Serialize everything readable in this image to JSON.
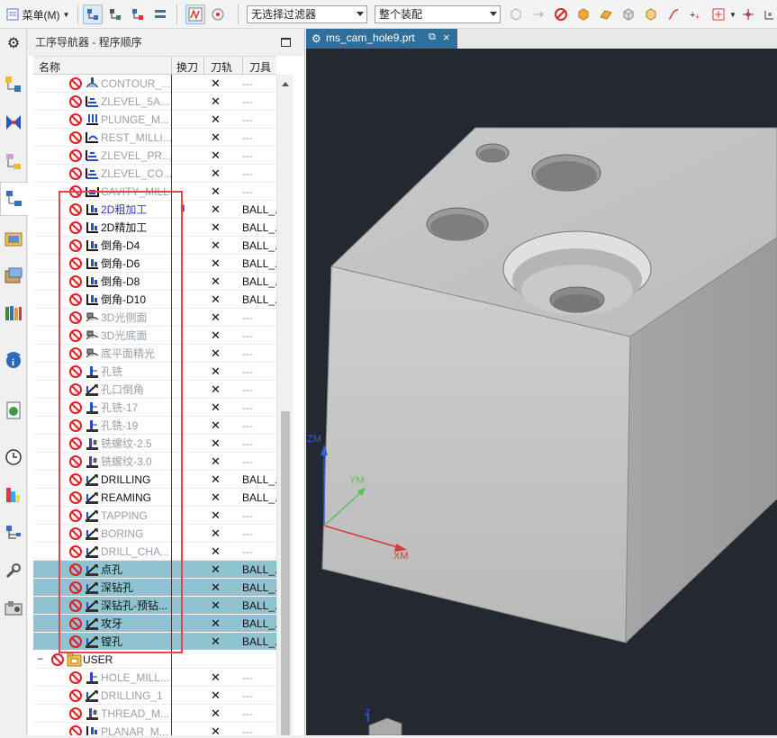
{
  "toolbar": {
    "menu_label": "菜单(M)",
    "filter_value": "无选择过滤器",
    "assembly_value": "整个装配"
  },
  "navigator": {
    "title": "工序导航器 - 程序顺序",
    "columns": [
      "名称",
      "换刀",
      "刀轨",
      "刀具"
    ]
  },
  "rows": [
    {
      "name": "CONTOUR_...",
      "style": "gray",
      "icon": "contour-op-icon",
      "path_mark": "✕",
      "tool": "---"
    },
    {
      "name": "ZLEVEL_5A...",
      "style": "gray",
      "icon": "zlevel-op-icon",
      "path_mark": "✕",
      "tool": "---"
    },
    {
      "name": "PLUNGE_M...",
      "style": "gray",
      "icon": "plunge-op-icon",
      "path_mark": "✕",
      "tool": "---"
    },
    {
      "name": "REST_MILLI...",
      "style": "gray",
      "icon": "rest-mill-op-icon",
      "path_mark": "✕",
      "tool": "---"
    },
    {
      "name": "ZLEVEL_PR...",
      "style": "gray",
      "icon": "zlevel-op-icon",
      "path_mark": "✕",
      "tool": "---"
    },
    {
      "name": "ZLEVEL_CO...",
      "style": "gray",
      "icon": "zlevel-op-icon",
      "path_mark": "✕",
      "tool": "---"
    },
    {
      "name": "CAVITY_MILL",
      "style": "gray",
      "icon": "cavity-op-icon",
      "path_mark": "✕",
      "tool": "---"
    },
    {
      "name": "2D粗加工",
      "style": "blue",
      "icon": "planar-op-icon",
      "path_mark": "✕",
      "tool": "BALL_...",
      "change_mark": "▮"
    },
    {
      "name": "2D精加工",
      "style": "blk",
      "icon": "planar-op-icon",
      "path_mark": "✕",
      "tool": "BALL_..."
    },
    {
      "name": "倒角-D4",
      "style": "blk",
      "icon": "planar-op-icon",
      "path_mark": "✕",
      "tool": "BALL_..."
    },
    {
      "name": "倒角-D6",
      "style": "blk",
      "icon": "planar-op-icon",
      "path_mark": "✕",
      "tool": "BALL_..."
    },
    {
      "name": "倒角-D8",
      "style": "blk",
      "icon": "planar-op-icon",
      "path_mark": "✕",
      "tool": "BALL_..."
    },
    {
      "name": "倒角-D10",
      "style": "blk",
      "icon": "planar-op-icon",
      "path_mark": "✕",
      "tool": "BALL_..."
    },
    {
      "name": "3D光侧面",
      "style": "gray",
      "icon": "surface-op-icon",
      "path_mark": "✕",
      "tool": "---"
    },
    {
      "name": "3D光底面",
      "style": "gray",
      "icon": "surface-op-icon",
      "path_mark": "✕",
      "tool": "---"
    },
    {
      "name": "底平面精光",
      "style": "gray",
      "icon": "surface-op-icon",
      "path_mark": "✕",
      "tool": "---"
    },
    {
      "name": "孔铣",
      "style": "gray",
      "icon": "hole-mill-op-icon",
      "path_mark": "✕",
      "tool": "---"
    },
    {
      "name": "孔口倒角",
      "style": "gray",
      "icon": "drill-op-icon",
      "path_mark": "✕",
      "tool": "---"
    },
    {
      "name": "孔铣-17",
      "style": "gray",
      "icon": "hole-mill-op-icon",
      "path_mark": "✕",
      "tool": "---"
    },
    {
      "name": "孔铣-19",
      "style": "gray",
      "icon": "hole-mill-op-icon",
      "path_mark": "✕",
      "tool": "---"
    },
    {
      "name": "铣螺纹-2.5",
      "style": "gray",
      "icon": "thread-mill-op-icon",
      "path_mark": "✕",
      "tool": "---"
    },
    {
      "name": "铣螺纹-3.0",
      "style": "gray",
      "icon": "thread-mill-op-icon",
      "path_mark": "✕",
      "tool": "---"
    },
    {
      "name": "DRILLING",
      "style": "blk",
      "icon": "drill-op-icon",
      "path_mark": "✕",
      "tool": "BALL_..."
    },
    {
      "name": "REAMING",
      "style": "blk",
      "icon": "drill-op-icon",
      "path_mark": "✕",
      "tool": "BALL_..."
    },
    {
      "name": "TAPPING",
      "style": "gray",
      "icon": "drill-op-icon",
      "path_mark": "✕",
      "tool": "---"
    },
    {
      "name": "BORING",
      "style": "gray",
      "icon": "drill-op-icon",
      "path_mark": "✕",
      "tool": "---"
    },
    {
      "name": "DRILL_CHA...",
      "style": "gray",
      "icon": "drill-op-icon",
      "path_mark": "✕",
      "tool": "---"
    },
    {
      "name": "点孔",
      "style": "blk",
      "icon": "drill-op-icon",
      "path_mark": "✕",
      "tool": "BALL_...",
      "selected": true
    },
    {
      "name": "深钻孔",
      "style": "blk",
      "icon": "drill-op-icon",
      "path_mark": "✕",
      "tool": "BALL_...",
      "selected": true
    },
    {
      "name": "深钻孔-预钻...",
      "style": "blk",
      "icon": "drill-op-icon",
      "path_mark": "✕",
      "tool": "BALL_...",
      "selected": true
    },
    {
      "name": "攻牙",
      "style": "blk",
      "icon": "drill-op-icon",
      "path_mark": "✕",
      "tool": "BALL_...",
      "selected": true
    },
    {
      "name": "镗孔",
      "style": "blk",
      "icon": "drill-op-icon",
      "path_mark": "✕",
      "tool": "BALL_...",
      "selected": true
    },
    {
      "name": "USER",
      "style": "blk",
      "icon": "program-folder-icon",
      "path_mark": "",
      "tool": "",
      "group": true
    },
    {
      "name": "HOLE_MILL...",
      "style": "gray",
      "icon": "hole-mill-op-icon",
      "path_mark": "✕",
      "tool": "---"
    },
    {
      "name": "DRILLING_1",
      "style": "gray",
      "icon": "drill-op-icon",
      "path_mark": "✕",
      "tool": "---"
    },
    {
      "name": "THREAD_M...",
      "style": "gray",
      "icon": "thread-mill-op-icon",
      "path_mark": "✕",
      "tool": "---"
    },
    {
      "name": "PLANAR_M...",
      "style": "gray",
      "icon": "planar-op-icon",
      "path_mark": "✕",
      "tool": "---"
    }
  ],
  "graphics": {
    "tab_label": "ms_cam_hole9.prt",
    "axes": {
      "x": "XM",
      "y": "YM",
      "z": "ZM",
      "small_z": "Z"
    },
    "colors": {
      "background": "#242830",
      "x_axis": "#d83a3a",
      "y_axis": "#5cc05c",
      "z_axis": "#3a58d8",
      "selection": "#8fc3cf",
      "highlight_box": "#e0484a"
    }
  }
}
